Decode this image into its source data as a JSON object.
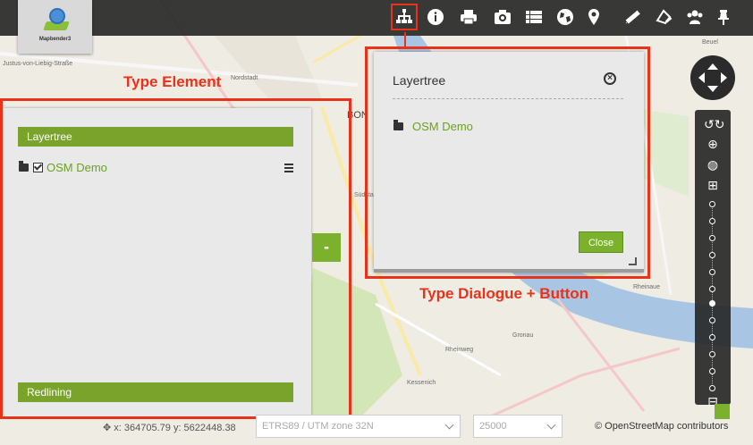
{
  "app": {
    "logo_text": "Mapbender3"
  },
  "toolbar": {
    "icons": [
      "layertree-icon",
      "info-icon",
      "print-icon",
      "camera-icon",
      "list-icon",
      "globe-icon",
      "map-pin-icon",
      "measure-line-icon",
      "measure-area-icon",
      "users-icon",
      "thumbtack-icon"
    ]
  },
  "annotations": {
    "element_label": "Type Element",
    "dialog_label": "Type Dialogue + Button"
  },
  "sidepane": {
    "header_top": "Layertree",
    "layer_name": "OSM Demo",
    "header_bottom": "Redlining",
    "collapse_label": "-"
  },
  "dialog": {
    "title": "Layertree",
    "layer_name": "OSM Demo",
    "close_button": "Close"
  },
  "map_labels": {
    "l1": "Justus-von-Liebig-Straße",
    "l2": "Nordstadt",
    "l3": "BON",
    "l4": "Gronau",
    "l5": "Kessenich",
    "l6": "Rheinweg",
    "l7": "Rheinaue",
    "l8": "Südstadt",
    "l9": "Beuel"
  },
  "footer": {
    "coords": "x: 364705.79 y: 5622448.38",
    "crs": "ETRS89 / UTM zone 32N",
    "scale": "25000",
    "attribution": "© OpenStreetMap contributors"
  }
}
